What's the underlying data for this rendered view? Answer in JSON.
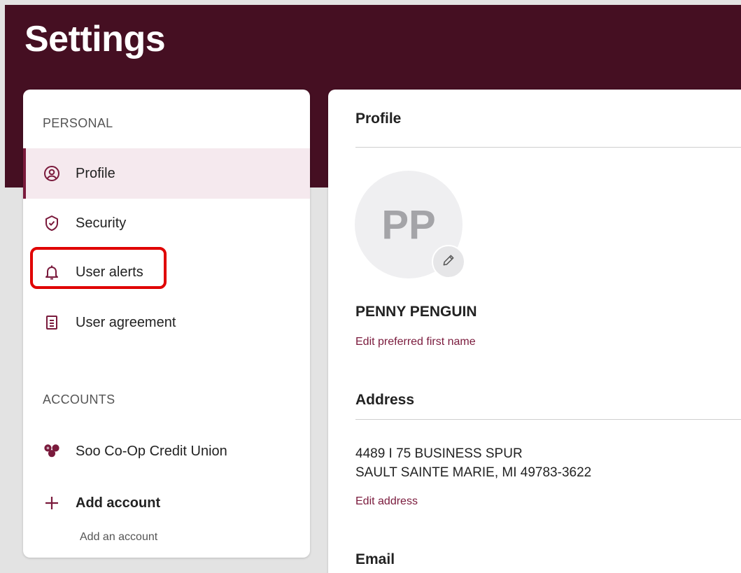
{
  "header": {
    "title": "Settings"
  },
  "sidebar": {
    "personal_heading": "PERSONAL",
    "items": [
      {
        "label": "Profile",
        "icon": "user-circle-icon"
      },
      {
        "label": "Security",
        "icon": "shield-check-icon"
      },
      {
        "label": "User alerts",
        "icon": "bell-icon"
      },
      {
        "label": "User agreement",
        "icon": "document-icon"
      }
    ],
    "accounts_heading": "ACCOUNTS",
    "accounts": [
      {
        "label": "Soo Co-Op Credit Union",
        "icon": "credit-union-logo-icon"
      }
    ],
    "add_account": {
      "label": "Add account",
      "sublabel": "Add an account",
      "icon": "plus-icon"
    }
  },
  "profile": {
    "title": "Profile",
    "avatar_initials": "PP",
    "name": "PENNY PENGUIN",
    "edit_name_link": "Edit preferred first name",
    "address_title": "Address",
    "address_lines": [
      "4489 I 75 BUSINESS SPUR",
      "SAULT SAINTE MARIE, MI 49783-3622"
    ],
    "edit_address_link": "Edit address",
    "email_title": "Email"
  },
  "colors": {
    "brand": "#450f22",
    "accent": "#7a1a3c",
    "active_bg": "#f5e9ee",
    "highlight": "#e00000"
  }
}
